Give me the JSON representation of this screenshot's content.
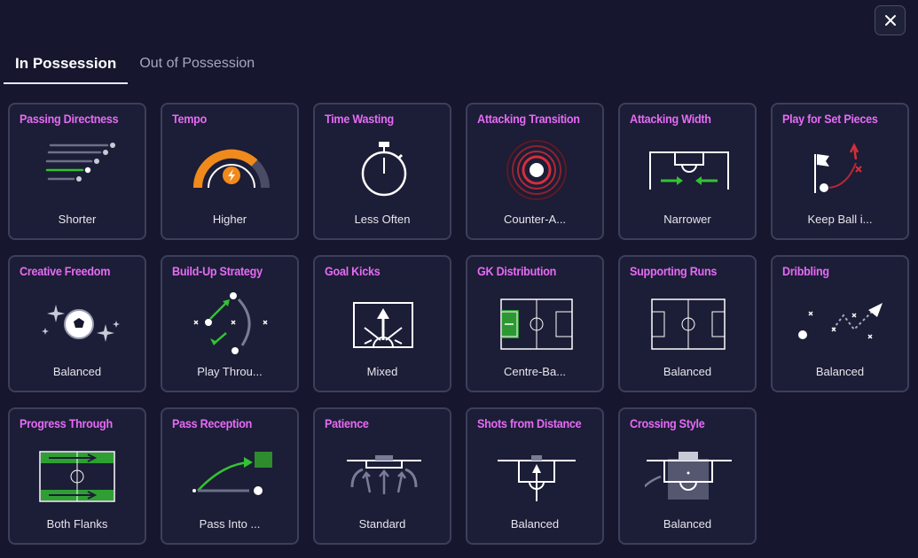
{
  "tabs": {
    "in_possession": "In Possession",
    "out_of_possession": "Out of Possession"
  },
  "cards": [
    {
      "title": "Passing Directness",
      "value": "Shorter",
      "icon": "passing-directness-icon"
    },
    {
      "title": "Tempo",
      "value": "Higher",
      "icon": "tempo-gauge-icon"
    },
    {
      "title": "Time Wasting",
      "value": "Less Often",
      "icon": "stopwatch-icon"
    },
    {
      "title": "Attacking Transition",
      "value": "Counter-A...",
      "icon": "target-rings-icon"
    },
    {
      "title": "Attacking Width",
      "value": "Narrower",
      "icon": "attacking-width-icon"
    },
    {
      "title": "Play for Set Pieces",
      "value": "Keep Ball i...",
      "icon": "corner-flag-icon"
    },
    {
      "title": "Creative Freedom",
      "value": "Balanced",
      "icon": "sparkle-ball-icon"
    },
    {
      "title": "Build-Up Strategy",
      "value": "Play Throu...",
      "icon": "build-up-icon"
    },
    {
      "title": "Goal Kicks",
      "value": "Mixed",
      "icon": "goal-kicks-icon"
    },
    {
      "title": "GK Distribution",
      "value": "Centre-Ba...",
      "icon": "gk-distribution-pitch-icon"
    },
    {
      "title": "Supporting Runs",
      "value": "Balanced",
      "icon": "supporting-runs-pitch-icon"
    },
    {
      "title": "Dribbling",
      "value": "Balanced",
      "icon": "dribbling-icon"
    },
    {
      "title": "Progress Through",
      "value": "Both Flanks",
      "icon": "progress-flanks-icon"
    },
    {
      "title": "Pass Reception",
      "value": "Pass Into ...",
      "icon": "pass-reception-icon"
    },
    {
      "title": "Patience",
      "value": "Standard",
      "icon": "patience-icon"
    },
    {
      "title": "Shots from Distance",
      "value": "Balanced",
      "icon": "shots-distance-icon"
    },
    {
      "title": "Crossing Style",
      "value": "Balanced",
      "icon": "crossing-style-icon"
    }
  ],
  "colors": {
    "accent_title": "#e56bf5",
    "active_green": "#33c233",
    "tempo_orange": "#f08a1c",
    "target_red": "#d32f3a"
  }
}
